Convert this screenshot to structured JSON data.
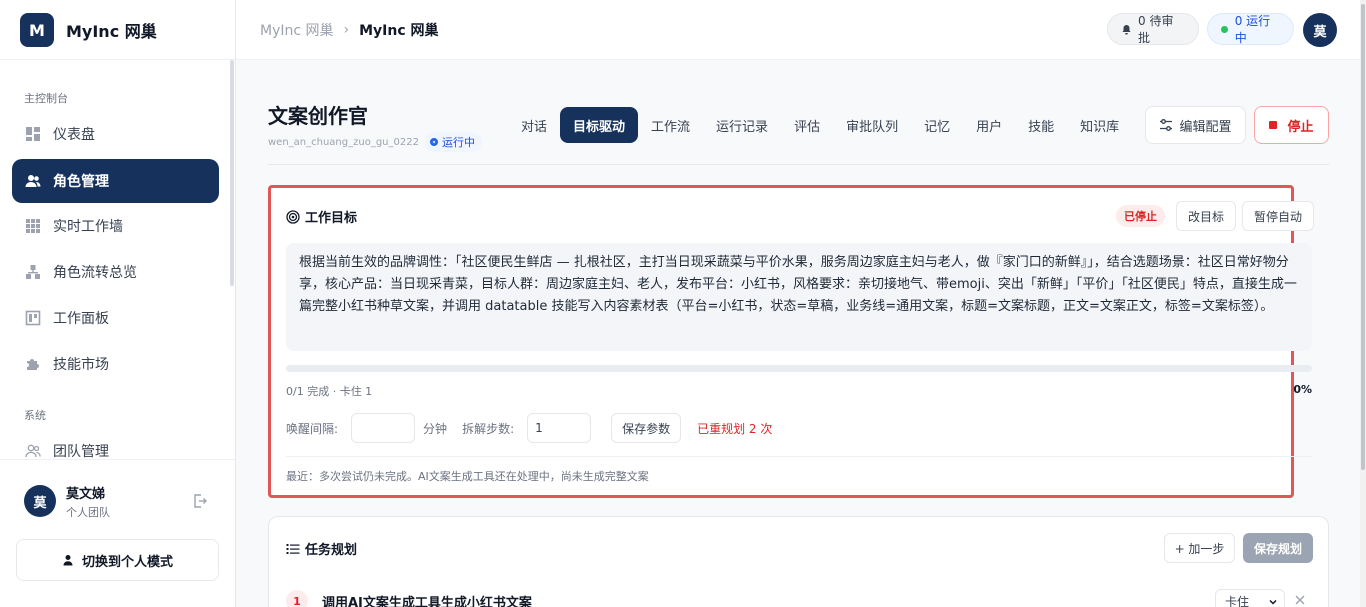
{
  "app": {
    "logo_letter": "M",
    "name": "MyInc 网巢"
  },
  "sidebar": {
    "section_main": "主控制台",
    "section_system": "系统",
    "items": [
      {
        "label": "仪表盘",
        "icon": "dashboard-icon"
      },
      {
        "label": "角色管理",
        "icon": "users-icon",
        "active": true
      },
      {
        "label": "实时工作墙",
        "icon": "grid-icon"
      },
      {
        "label": "角色流转总览",
        "icon": "flow-icon"
      },
      {
        "label": "工作面板",
        "icon": "panel-icon"
      },
      {
        "label": "技能市场",
        "icon": "puzzle-icon"
      }
    ],
    "system_items": [
      {
        "label": "团队管理",
        "icon": "team-icon"
      }
    ],
    "user": {
      "avatar": "莫",
      "name": "莫文娣",
      "team": "个人团队"
    },
    "switch_label": "切换到个人模式"
  },
  "topbar": {
    "crumb_parent": "MyInc 网巢",
    "crumb_separator": "›",
    "crumb_current": "MyInc 网巢",
    "pending": "0 待审批",
    "running": "0 运行中",
    "avatar": "莫"
  },
  "agent": {
    "title": "文案创作官",
    "slug": "wen_an_chuang_zuo_gu_0222",
    "status": "运行中"
  },
  "tabs": [
    {
      "label": "对话"
    },
    {
      "label": "目标驱动",
      "active": true
    },
    {
      "label": "工作流"
    },
    {
      "label": "运行记录"
    },
    {
      "label": "评估"
    },
    {
      "label": "审批队列"
    },
    {
      "label": "记忆"
    },
    {
      "label": "用户"
    },
    {
      "label": "技能"
    },
    {
      "label": "知识库"
    }
  ],
  "actions": {
    "edit_config": "编辑配置",
    "stop": "停止"
  },
  "goal": {
    "title": "工作目标",
    "status_badge": "已停止",
    "change_goal": "改目标",
    "pause_auto": "暂停自动",
    "text": "根据当前生效的品牌调性：「社区便民生鲜店 — 扎根社区，主打当日现采蔬菜与平价水果，服务周边家庭主妇与老人，做『家门口的新鲜』」，结合选题场景：社区日常好物分享，核心产品：当日现采青菜，目标人群：周边家庭主妇、老人，发布平台：小红书，风格要求：亲切接地气、带emoji、突出「新鲜」「平价」「社区便民」特点，直接生成一篇完整小红书种草文案，并调用 datatable 技能写入内容素材表（平台=小红书，状态=草稿，业务线=通用文案，标题=文案标题，正文=文案正文，标签=文案标签）。",
    "progress": 0,
    "progress_text": "0/1 完成 · 卡住 1",
    "progress_pct": "0%",
    "wake_interval_label": "唤醒间隔:",
    "wake_interval_value": "",
    "wake_interval_unit": "分钟",
    "split_steps_label": "拆解步数:",
    "split_steps_value": "1",
    "save_params": "保存参数",
    "replan_text": "已重规划 2 次",
    "recent": "最近：多次尝试仍未完成。AI文案生成工具还在处理中，尚未生成完整文案"
  },
  "plan": {
    "title": "任务规划",
    "add_step": "+ 加一步",
    "save_plan": "保存规划",
    "steps": [
      {
        "num": "1",
        "label": "调用AI文案生成工具生成小红书文案",
        "status": "卡住"
      }
    ]
  },
  "colors": {
    "brand": "#16325c",
    "danger": "#dc2626",
    "running": "#1d4ed8",
    "highlight_border": "#e15656"
  }
}
